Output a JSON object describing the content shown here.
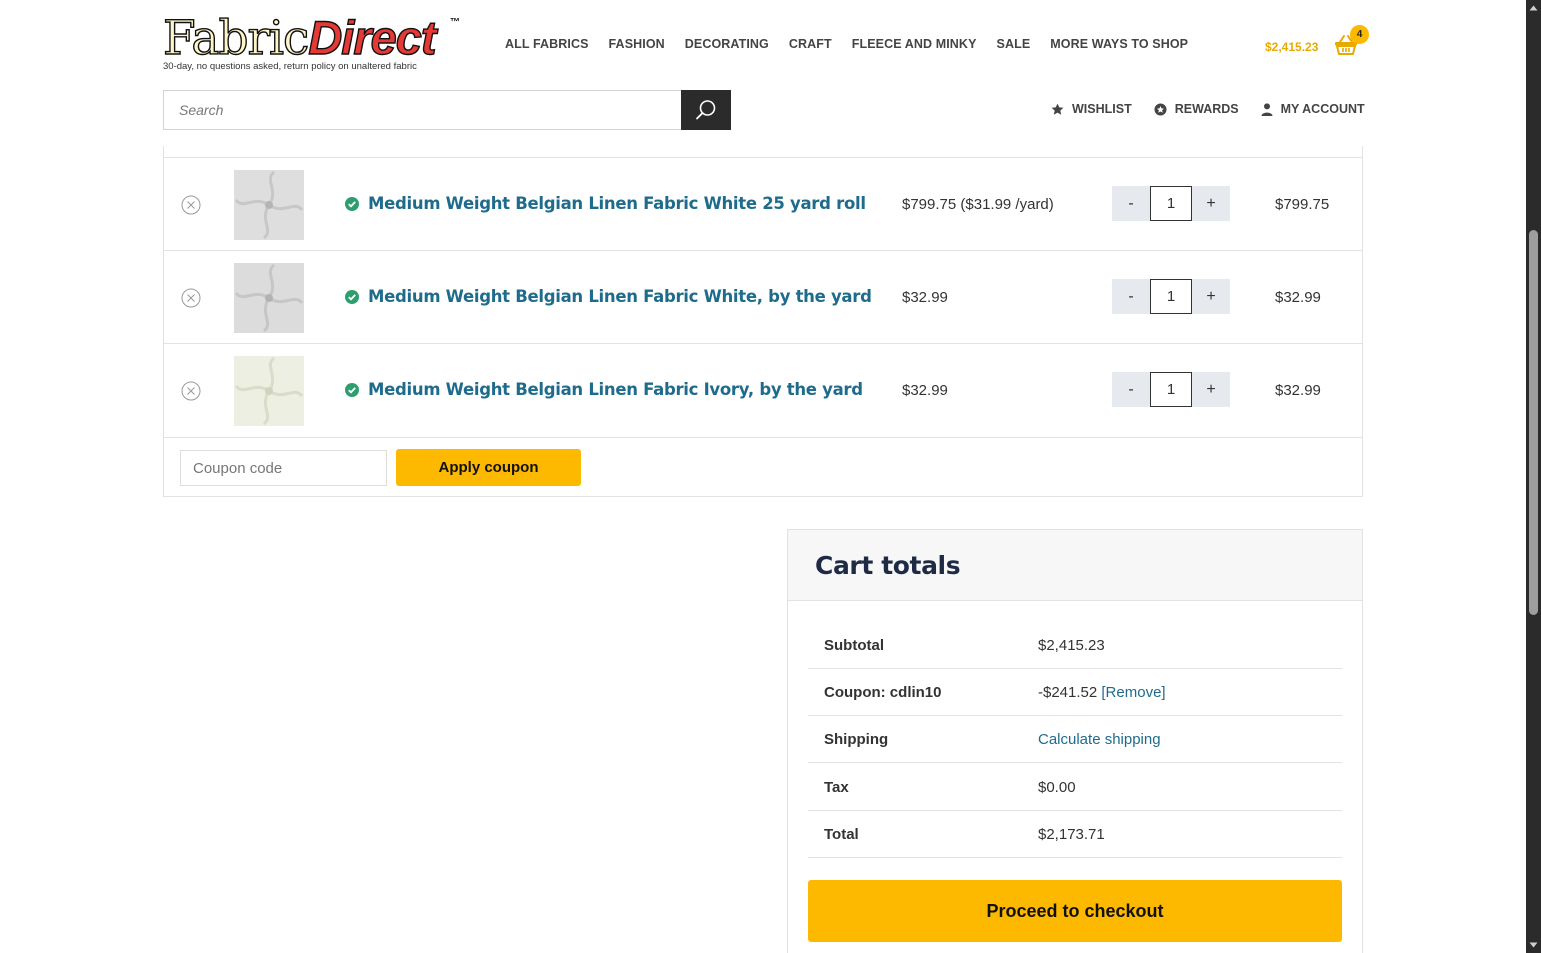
{
  "header": {
    "logo": {
      "word1": "Fabric",
      "word2": "Direct",
      "tm": "™",
      "tagline": "30-day, no questions asked, return policy on unaltered fabric"
    },
    "nav": [
      "ALL FABRICS",
      "FASHION",
      "DECORATING",
      "CRAFT",
      "FLEECE AND MINKY",
      "SALE",
      "MORE WAYS TO SHOP"
    ],
    "cart_total": "$2,415.23",
    "cart_count": "4",
    "search_placeholder": "Search",
    "subnav": {
      "wishlist": "WISHLIST",
      "rewards": "REWARDS",
      "account": "MY ACCOUNT"
    }
  },
  "cart": {
    "items": [
      {
        "name": "Medium Weight Belgian Linen Fabric White 25 yard roll",
        "price": "$799.75 ($31.99 /yard)",
        "qty": "1",
        "subtotal": "$799.75",
        "swatch": "#dedede"
      },
      {
        "name": "Medium Weight Belgian Linen Fabric White, by the yard",
        "price": "$32.99",
        "qty": "1",
        "subtotal": "$32.99",
        "swatch": "#dcdcdc"
      },
      {
        "name": "Medium Weight Belgian Linen Fabric Ivory, by the yard",
        "price": "$32.99",
        "qty": "1",
        "subtotal": "$32.99",
        "swatch": "#ecefe2"
      }
    ],
    "qty_minus": "-",
    "qty_plus": "+",
    "coupon_placeholder": "Coupon code",
    "apply_coupon": "Apply coupon"
  },
  "totals": {
    "title": "Cart totals",
    "subtotal_label": "Subtotal",
    "subtotal_value": "$2,415.23",
    "coupon_label": "Coupon: cdlin10",
    "coupon_value": "-$241.52",
    "coupon_remove": "[Remove]",
    "shipping_label": "Shipping",
    "shipping_value": "Calculate shipping",
    "tax_label": "Tax",
    "tax_value": "$0.00",
    "total_label": "Total",
    "total_value": "$2,173.71",
    "checkout": "Proceed to checkout"
  },
  "colors": {
    "accent": "#fcb900",
    "link": "#1e6b8c",
    "in_stock": "#2e9e6f",
    "logo_red": "#e53935"
  }
}
